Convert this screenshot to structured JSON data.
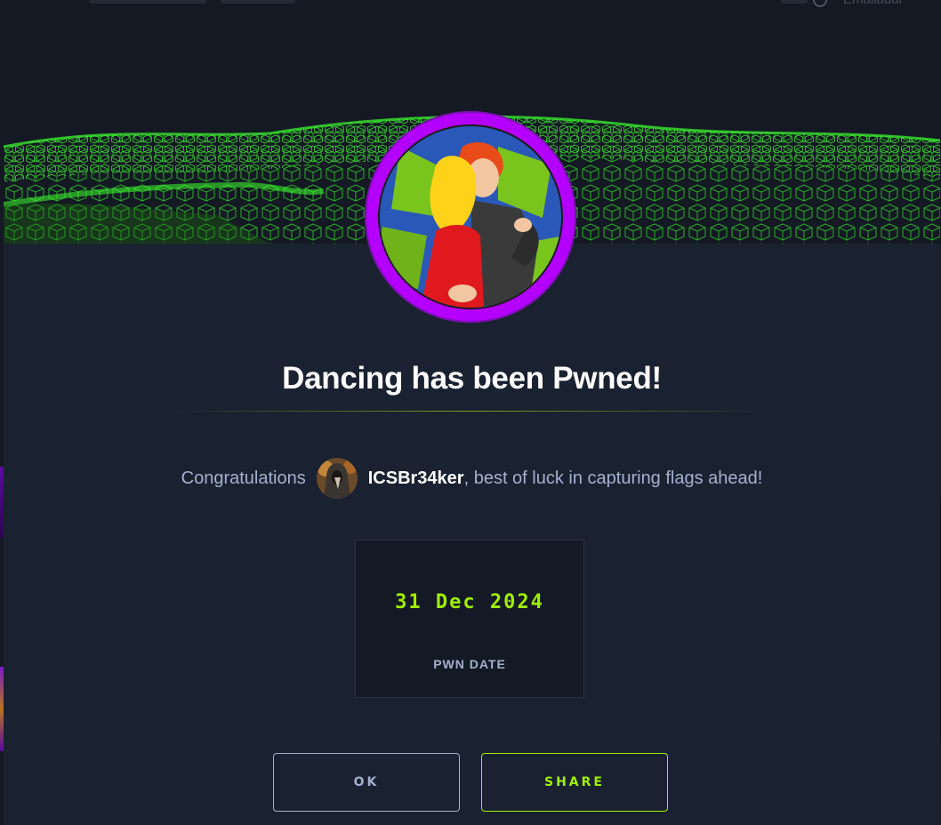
{
  "modal": {
    "title": "Dancing has been Pwned!",
    "congrats_prefix": "Congratulations",
    "username": "ICSBr34ker",
    "congrats_suffix": ", best of luck in capturing flags ahead!",
    "stat": {
      "value": "31 Dec 2024",
      "label": "PWN DATE"
    },
    "buttons": {
      "ok_label": "OK",
      "share_label": "SHARE"
    }
  },
  "background": {
    "header_text": "Emailaddr"
  },
  "icons": {
    "machine_avatar": "dancing-couple-avatar",
    "user_avatar": "hooded-figure-avatar"
  },
  "colors": {
    "accent_green": "#9fef00",
    "ring_purple": "#b400ff",
    "modal_bg": "#1a2130",
    "text_muted": "#a4b1cd"
  }
}
